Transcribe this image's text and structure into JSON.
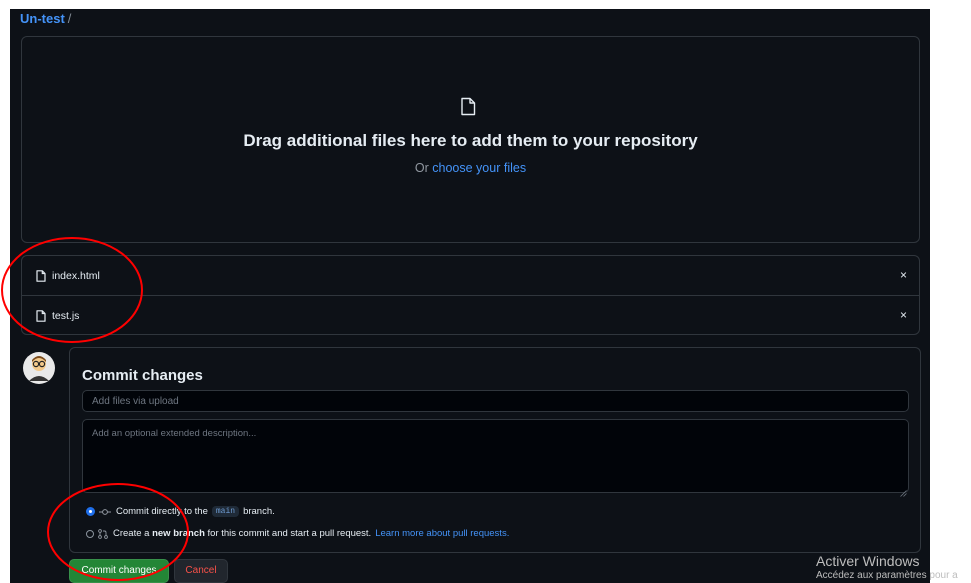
{
  "breadcrumb": {
    "repo": "Un-test",
    "separator": "/"
  },
  "dropzone": {
    "title": "Drag additional files here to add them to your repository",
    "or_text": "Or",
    "choose_link": "choose your files"
  },
  "files": [
    {
      "name": "index.html",
      "remove": "×"
    },
    {
      "name": "test.js",
      "remove": "×"
    }
  ],
  "commit": {
    "title": "Commit changes",
    "summary_placeholder": "Add files via upload",
    "summary_value": "",
    "description_placeholder": "Add an optional extended description...",
    "option_direct": {
      "prefix": "Commit directly to the",
      "branch": "main",
      "suffix": "branch.",
      "selected": true
    },
    "option_new_branch": {
      "prefix": "Create a",
      "bold": "new branch",
      "suffix": "for this commit and start a pull request.",
      "link": "Learn more about pull requests.",
      "selected": false
    }
  },
  "buttons": {
    "commit": "Commit changes",
    "cancel": "Cancel"
  },
  "watermark": {
    "line1": "Activer Windows",
    "line2": "Accédez aux paramètres pour a"
  },
  "colors": {
    "background": "#0d1117",
    "border": "#30363d",
    "link": "#4493f8",
    "primary_button": "#238636",
    "danger_text": "#f85149",
    "annotation": "#ff0000"
  },
  "icons": {
    "dropzone": "file-icon",
    "file_rows": "file-icon",
    "remove": "close-icon",
    "commit_option": "git-commit-icon",
    "branch_option": "git-pull-request-icon"
  }
}
